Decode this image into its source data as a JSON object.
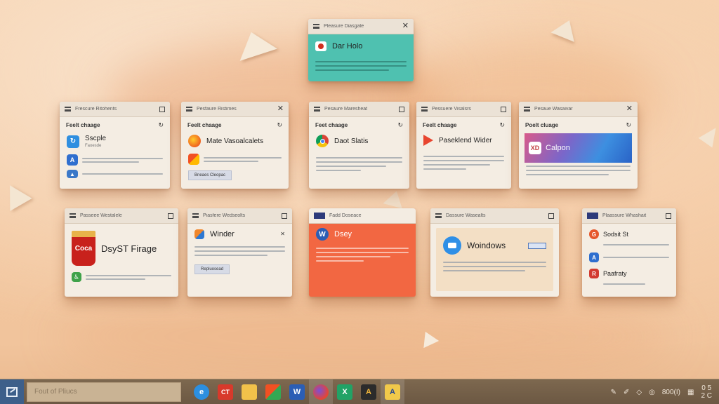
{
  "windows": {
    "top": {
      "title": "Pleasure Diasgate",
      "app_name": "Dar Holo"
    },
    "r1c1": {
      "title": "Frescure Ritohents",
      "subheader": "Feelt chaage",
      "app_name": "Sscple",
      "app_sub": "Faoesde"
    },
    "r1c2": {
      "title": "Pesfaure Ristimes",
      "subheader": "Feelt chaage",
      "app_name": "Mate Vasoalcalets",
      "button_label": "Bneaes Cleopac"
    },
    "r1c3": {
      "title": "Pesaure Maresheat",
      "subheader": "Feet chaage",
      "app_name": "Daot Slatis"
    },
    "r1c4": {
      "title": "Pessuere Visalsrs",
      "subheader": "Feelt chaage",
      "app_name": "Paseklend Wider"
    },
    "r1c5": {
      "title": "Pesaue Wasaivar",
      "subheader": "Poelt cluage",
      "app_name": "Calpon"
    },
    "r2c1": {
      "title": "Passeee Westalele",
      "app_name": "DsyST Firage"
    },
    "r2c2": {
      "title": "Piasfere Wedseolts",
      "app_name": "Winder",
      "button_label": "Repluosead"
    },
    "r2c3": {
      "title": "Fadd Doseace",
      "app_name": "Dsey"
    },
    "r2c4": {
      "title": "Dassure Wasealts",
      "app_name": "Woindows"
    },
    "r2c5": {
      "title": "Plaassure Whashait",
      "items": [
        "Sodsit St",
        "Paafraty"
      ]
    }
  },
  "taskbar": {
    "search_placeholder": "Fout of Pliucs",
    "tray_text": "800(I)",
    "clock_line1": "0 5",
    "clock_line2": "2 C"
  },
  "colors": {
    "accent_teal": "#4fc1b0",
    "accent_orange": "#f26742",
    "taskbar_bg": "#7d684f"
  }
}
